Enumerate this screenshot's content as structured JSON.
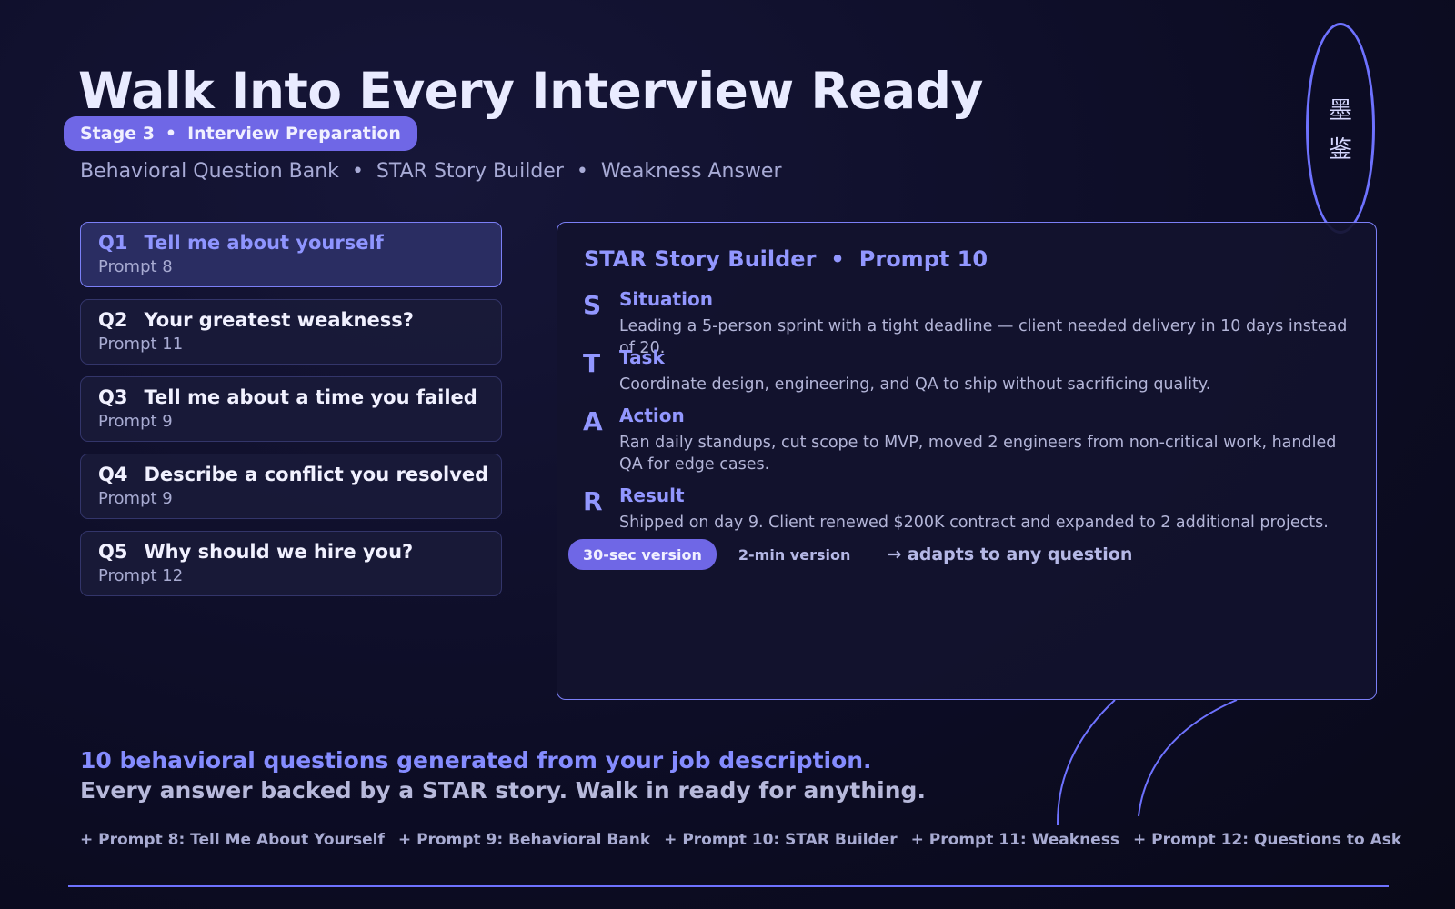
{
  "header": {
    "title": "Walk Into Every Interview Ready",
    "stage": "Stage 3",
    "stage_sep": "•",
    "stage_label": "Interview Preparation",
    "subnav": [
      "Behavioral Question Bank",
      "•",
      "STAR Story Builder",
      "•",
      "Weakness Answer"
    ]
  },
  "seal": {
    "char1": "墨",
    "char2": "鉴"
  },
  "questions": [
    {
      "num": "Q1",
      "title": "Tell me about yourself",
      "prompt": "Prompt 8",
      "active": true
    },
    {
      "num": "Q2",
      "title": "Your greatest weakness?",
      "prompt": "Prompt 11",
      "active": false
    },
    {
      "num": "Q3",
      "title": "Tell me about a time you failed",
      "prompt": "Prompt 9",
      "active": false
    },
    {
      "num": "Q4",
      "title": "Describe a conflict you resolved",
      "prompt": "Prompt 9",
      "active": false
    },
    {
      "num": "Q5",
      "title": "Why should we hire you?",
      "prompt": "Prompt 12",
      "active": false
    }
  ],
  "star": {
    "title": "STAR Story Builder",
    "sep": "•",
    "prompt": "Prompt 10",
    "rows": [
      {
        "letter": "S",
        "label": "Situation",
        "text": "Leading a 5-person sprint with a tight deadline — client needed delivery in 10 days instead of 20."
      },
      {
        "letter": "T",
        "label": "Task",
        "text": "Coordinate design, engineering, and QA to ship without sacrificing quality."
      },
      {
        "letter": "A",
        "label": "Action",
        "text": "Ran daily standups, cut scope to MVP, moved 2 engineers from non-critical work, handled QA for edge cases."
      },
      {
        "letter": "R",
        "label": "Result",
        "text": "Shipped on day 9. Client renewed $200K contract and expanded to 2 additional projects."
      }
    ],
    "versions": {
      "short": "30-sec version",
      "long": "2-min version",
      "adapt": "→ adapts to any question"
    }
  },
  "bottom": {
    "line1": "10 behavioral questions generated from your job description.",
    "line2": "Every answer backed by a STAR story. Walk in ready for anything.",
    "prompts": [
      "+ Prompt 8: Tell Me About Yourself",
      "+ Prompt 9: Behavioral Bank",
      "+ Prompt 10: STAR Builder",
      "+ Prompt 11: Weakness",
      "+ Prompt 12: Questions to Ask"
    ]
  },
  "colors": {
    "accent": "#6f67e6",
    "accent_text": "#9297ff",
    "background": "#0d0d26",
    "border": "#7b7ff6"
  }
}
